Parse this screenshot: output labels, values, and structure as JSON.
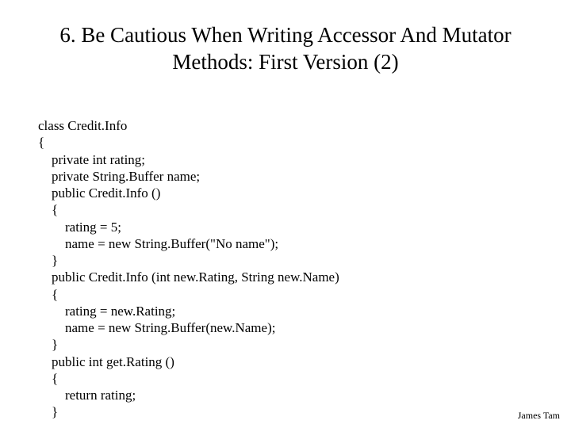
{
  "title_line1": "6. Be Cautious When Writing Accessor And Mutator",
  "title_line2": "Methods: First Version (2)",
  "code": "class Credit.Info\n{\n    private int rating;\n    private String.Buffer name;\n    public Credit.Info ()\n    {\n        rating = 5;\n        name = new String.Buffer(\"No name\");\n    }\n    public Credit.Info (int new.Rating, String new.Name)\n    {\n        rating = new.Rating;\n        name = new String.Buffer(new.Name);\n    }\n    public int get.Rating ()\n    {\n        return rating;\n    }",
  "footer": "James Tam"
}
